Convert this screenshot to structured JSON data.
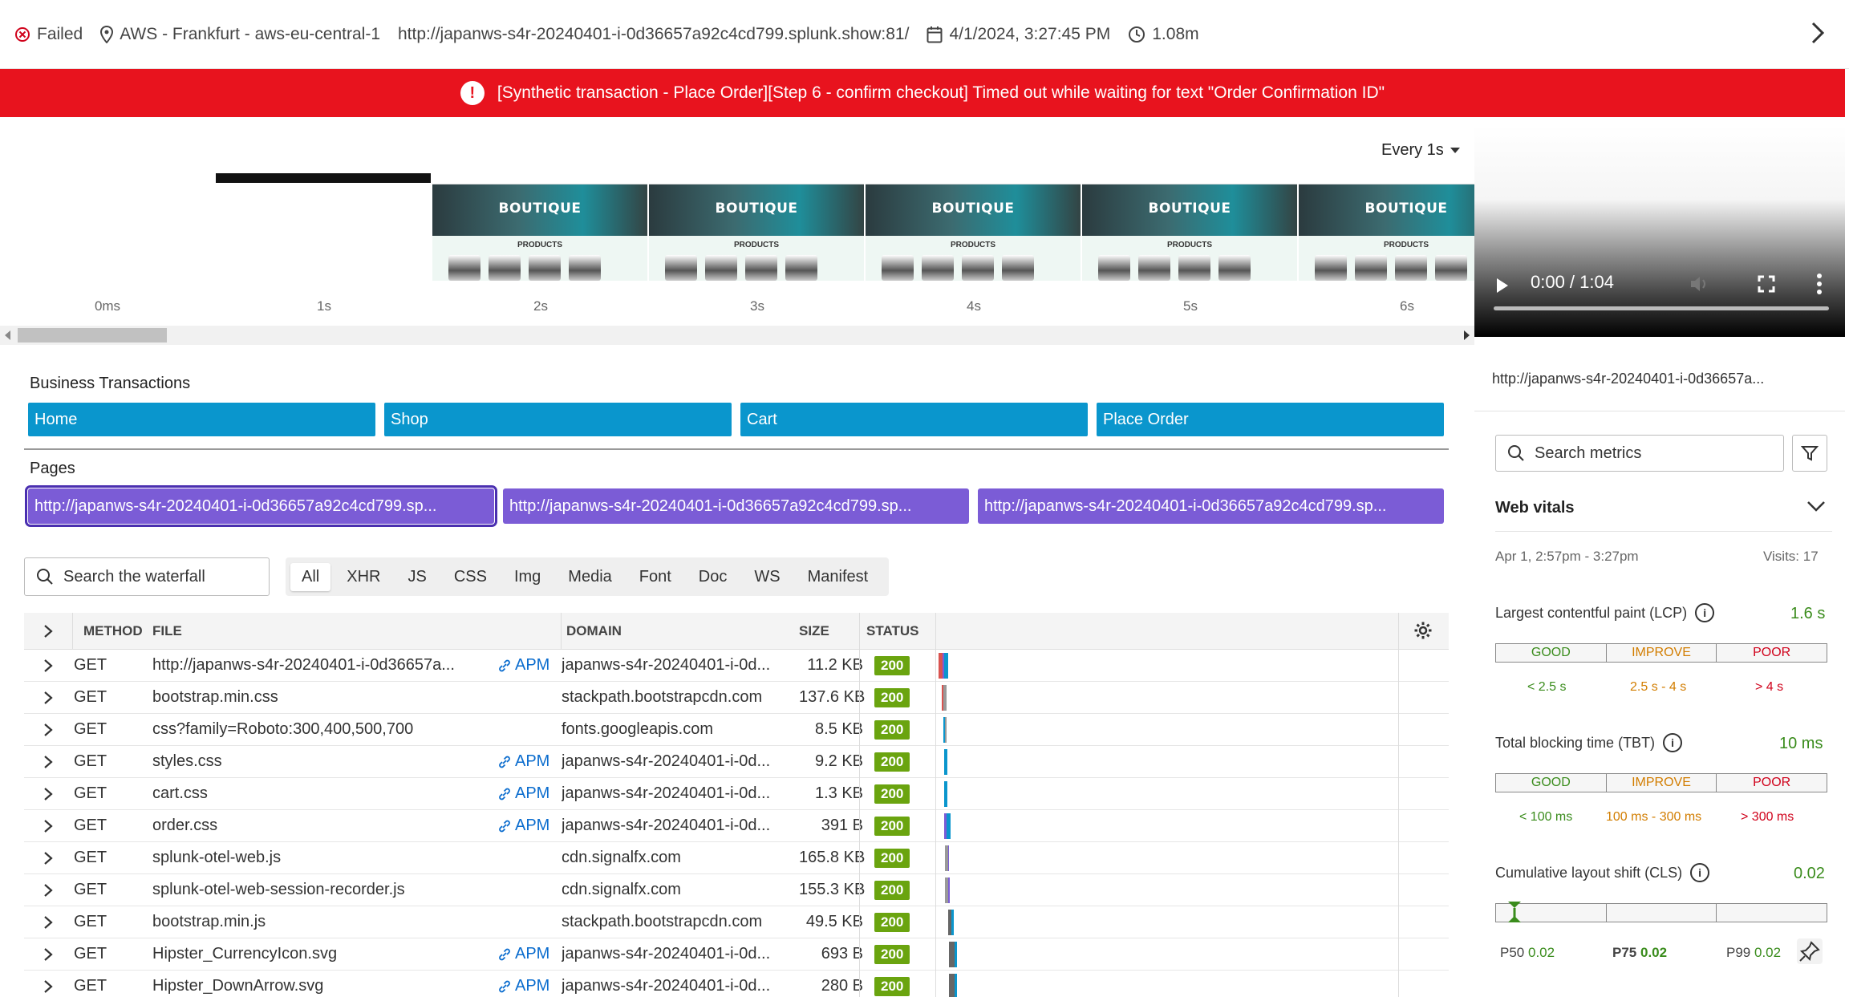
{
  "header": {
    "status": "Failed",
    "location": "AWS - Frankfurt - aws-eu-central-1",
    "url": "http://japanws-s4r-20240401-i-0d36657a92c4cd799.splunk.show:81/",
    "datetime": "4/1/2024, 3:27:45 PM",
    "duration": "1.08m"
  },
  "alert": {
    "message": "[Synthetic transaction - Place Order][Step 6 - confirm checkout] Timed out while waiting for text \"Order Confirmation ID\""
  },
  "filmstrip": {
    "interval_label": "Every 1s",
    "frame_title": "BOUTIQUE",
    "frame_section": "PRODUCTS",
    "ticks": [
      "0ms",
      "1s",
      "2s",
      "3s",
      "4s",
      "5s",
      "6s"
    ]
  },
  "video": {
    "time": "0:00 / 1:04"
  },
  "business_transactions": {
    "label": "Business Transactions",
    "items": [
      "Home",
      "Shop",
      "Cart",
      "Place Order"
    ]
  },
  "pages": {
    "label": "Pages",
    "items": [
      "http://japanws-s4r-20240401-i-0d36657a92c4cd799.sp...",
      "http://japanws-s4r-20240401-i-0d36657a92c4cd799.sp...",
      "http://japanws-s4r-20240401-i-0d36657a92c4cd799.sp..."
    ]
  },
  "waterfall": {
    "search_placeholder": "Search the waterfall",
    "filters": [
      "All",
      "XHR",
      "JS",
      "CSS",
      "Img",
      "Media",
      "Font",
      "Doc",
      "WS",
      "Manifest"
    ],
    "active_filter": "All",
    "columns": [
      "METHOD",
      "FILE",
      "DOMAIN",
      "SIZE",
      "STATUS"
    ],
    "apm_label": "APM",
    "rows": [
      {
        "method": "GET",
        "file": "http://japanws-s4r-20240401-i-0d36657a...",
        "apm": true,
        "domain": "japanws-s4r-20240401-i-0d...",
        "size": "11.2 KB",
        "status": "200"
      },
      {
        "method": "GET",
        "file": "bootstrap.min.css",
        "apm": false,
        "domain": "stackpath.bootstrapcdn.com",
        "size": "137.6 KB",
        "status": "200"
      },
      {
        "method": "GET",
        "file": "css?family=Roboto:300,400,500,700",
        "apm": false,
        "domain": "fonts.googleapis.com",
        "size": "8.5 KB",
        "status": "200"
      },
      {
        "method": "GET",
        "file": "styles.css",
        "apm": true,
        "domain": "japanws-s4r-20240401-i-0d...",
        "size": "9.2 KB",
        "status": "200"
      },
      {
        "method": "GET",
        "file": "cart.css",
        "apm": true,
        "domain": "japanws-s4r-20240401-i-0d...",
        "size": "1.3 KB",
        "status": "200"
      },
      {
        "method": "GET",
        "file": "order.css",
        "apm": true,
        "domain": "japanws-s4r-20240401-i-0d...",
        "size": "391 B",
        "status": "200"
      },
      {
        "method": "GET",
        "file": "splunk-otel-web.js",
        "apm": false,
        "domain": "cdn.signalfx.com",
        "size": "165.8 KB",
        "status": "200"
      },
      {
        "method": "GET",
        "file": "splunk-otel-web-session-recorder.js",
        "apm": false,
        "domain": "cdn.signalfx.com",
        "size": "155.3 KB",
        "status": "200"
      },
      {
        "method": "GET",
        "file": "bootstrap.min.js",
        "apm": false,
        "domain": "stackpath.bootstrapcdn.com",
        "size": "49.5 KB",
        "status": "200"
      },
      {
        "method": "GET",
        "file": "Hipster_CurrencyIcon.svg",
        "apm": true,
        "domain": "japanws-s4r-20240401-i-0d...",
        "size": "693 B",
        "status": "200"
      },
      {
        "method": "GET",
        "file": "Hipster_DownArrow.svg",
        "apm": true,
        "domain": "japanws-s4r-20240401-i-0d...",
        "size": "280 B",
        "status": "200"
      }
    ]
  },
  "right_panel": {
    "url": "http://japanws-s4r-20240401-i-0d36657a...",
    "search_placeholder": "Search metrics",
    "section_title": "Web vitals",
    "date_range": "Apr 1, 2:57pm - 3:27pm",
    "visits": "Visits: 17",
    "scale_labels": [
      "GOOD",
      "IMPROVE",
      "POOR"
    ],
    "lcp": {
      "name": "Largest contentful paint (LCP)",
      "value": "1.6 s",
      "good": "< 2.5 s",
      "improve": "2.5 s - 4 s",
      "poor": "> 4 s"
    },
    "tbt": {
      "name": "Total blocking time (TBT)",
      "value": "10 ms",
      "good": "< 100 ms",
      "improve": "100 ms - 300 ms",
      "poor": "> 300 ms"
    },
    "cls": {
      "name": "Cumulative layout shift (CLS)",
      "value": "0.02",
      "p50_label": "P50",
      "p50": "0.02",
      "p75_label": "P75",
      "p75": "0.02",
      "p99_label": "P99",
      "p99": "0.02"
    }
  },
  "colors": {
    "alert": "#e8131e",
    "business_transaction": "#0a96cd",
    "page": "#7b5cd6",
    "status_ok": "#6aa40f",
    "good": "#3a8c1c",
    "improve": "#d27d00",
    "poor": "#d0021b"
  }
}
